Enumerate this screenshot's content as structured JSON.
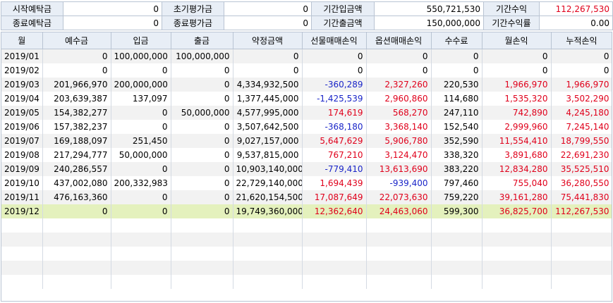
{
  "summary": {
    "row1": [
      {
        "label": "시작예탁금",
        "value": "0"
      },
      {
        "label": "초기평가금",
        "value": "0"
      },
      {
        "label": "기간입금액",
        "value": "550,721,530"
      },
      {
        "label": "기간수익",
        "value": "112,267,530",
        "red": true
      }
    ],
    "row2": [
      {
        "label": "종료예탁금",
        "value": "0"
      },
      {
        "label": "종료평가금",
        "value": "0"
      },
      {
        "label": "기간출금액",
        "value": "150,000,000"
      },
      {
        "label": "기간수익률",
        "value": "0.00"
      }
    ]
  },
  "grid": {
    "columns": [
      "월",
      "예수금",
      "입금",
      "출금",
      "약정금액",
      "선물매매손익",
      "옵션매매손익",
      "수수료",
      "월손익",
      "누적손익"
    ],
    "rows": [
      {
        "month": "2019/01",
        "deposit": "0",
        "in": "100,000,000",
        "out": "100,000,000",
        "contract": "0",
        "futures": "0",
        "options": "0",
        "fee": "0",
        "monthly": "0",
        "cumul": "0"
      },
      {
        "month": "2019/02",
        "deposit": "0",
        "in": "0",
        "out": "0",
        "contract": "0",
        "futures": "0",
        "options": "0",
        "fee": "0",
        "monthly": "0",
        "cumul": "0"
      },
      {
        "month": "2019/03",
        "deposit": "201,966,970",
        "in": "200,000,000",
        "out": "0",
        "contract": "4,334,932,500",
        "futures": "-360,289",
        "options": "2,327,260",
        "fee": "220,530",
        "monthly": "1,966,970",
        "cumul": "1,966,970"
      },
      {
        "month": "2019/04",
        "deposit": "203,639,387",
        "in": "137,097",
        "out": "0",
        "contract": "1,377,445,000",
        "futures": "-1,425,539",
        "options": "2,960,860",
        "fee": "114,680",
        "monthly": "1,535,320",
        "cumul": "3,502,290"
      },
      {
        "month": "2019/05",
        "deposit": "154,382,277",
        "in": "0",
        "out": "50,000,000",
        "contract": "4,577,995,000",
        "futures": "174,619",
        "options": "568,270",
        "fee": "247,110",
        "monthly": "742,890",
        "cumul": "4,245,180"
      },
      {
        "month": "2019/06",
        "deposit": "157,382,237",
        "in": "0",
        "out": "0",
        "contract": "3,507,642,500",
        "futures": "-368,180",
        "options": "3,368,140",
        "fee": "152,540",
        "monthly": "2,999,960",
        "cumul": "7,245,140"
      },
      {
        "month": "2019/07",
        "deposit": "169,188,097",
        "in": "251,450",
        "out": "0",
        "contract": "9,027,157,000",
        "futures": "5,647,629",
        "options": "5,906,780",
        "fee": "352,590",
        "monthly": "11,554,410",
        "cumul": "18,799,550"
      },
      {
        "month": "2019/08",
        "deposit": "217,294,777",
        "in": "50,000,000",
        "out": "0",
        "contract": "9,537,815,000",
        "futures": "767,210",
        "options": "3,124,470",
        "fee": "338,320",
        "monthly": "3,891,680",
        "cumul": "22,691,230"
      },
      {
        "month": "2019/09",
        "deposit": "240,286,557",
        "in": "0",
        "out": "0",
        "contract": "10,903,140,000",
        "futures": "-779,410",
        "options": "13,613,690",
        "fee": "383,220",
        "monthly": "12,834,280",
        "cumul": "35,525,510"
      },
      {
        "month": "2019/10",
        "deposit": "437,002,080",
        "in": "200,332,983",
        "out": "0",
        "contract": "22,729,140,000",
        "futures": "1,694,439",
        "options": "-939,400",
        "fee": "797,460",
        "monthly": "755,040",
        "cumul": "36,280,550"
      },
      {
        "month": "2019/11",
        "deposit": "476,163,360",
        "in": "0",
        "out": "0",
        "contract": "21,620,154,500",
        "futures": "17,087,649",
        "options": "22,073,630",
        "fee": "759,220",
        "monthly": "39,161,280",
        "cumul": "75,441,830"
      },
      {
        "month": "2019/12",
        "deposit": "0",
        "in": "0",
        "out": "0",
        "contract": "19,749,360,000",
        "futures": "12,362,640",
        "options": "24,463,060",
        "fee": "599,300",
        "monthly": "36,825,700",
        "cumul": "112,267,530",
        "selected": true
      }
    ]
  },
  "colors": {
    "positive": "#e0001b",
    "negative": "#1a25c8",
    "header_bg": "#e8eef6",
    "selected_row": "#e4f1bd"
  }
}
